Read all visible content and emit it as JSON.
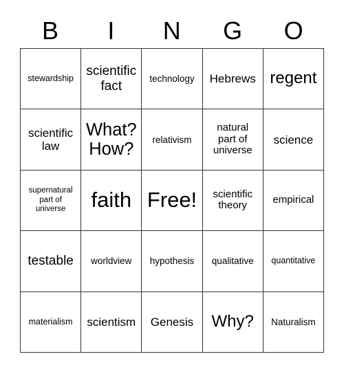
{
  "card": {
    "type": "bingo-card",
    "columns": 5,
    "rows": 5,
    "header_letters": [
      "B",
      "I",
      "N",
      "G",
      "O"
    ],
    "free_space_label": "Free!",
    "grid_line_color": "#333333",
    "background_color": "#ffffff",
    "text_color": "#000000",
    "cells": [
      [
        {
          "text": "stewardship",
          "size": "xs"
        },
        {
          "text": "scientific\nfact",
          "size": "l"
        },
        {
          "text": "technology",
          "size": "s"
        },
        {
          "text": "Hebrews",
          "size": "ml"
        },
        {
          "text": "regent",
          "size": "xl"
        }
      ],
      [
        {
          "text": "scientific\nlaw",
          "size": "ml"
        },
        {
          "text": "What?\nHow?",
          "size": "xxl"
        },
        {
          "text": "relativism",
          "size": "s"
        },
        {
          "text": "natural\npart of\nuniverse",
          "size": "m"
        },
        {
          "text": "science",
          "size": "ml"
        }
      ],
      [
        {
          "text": "supernatural\npart of\nuniverse",
          "size": "xxs"
        },
        {
          "text": "faith",
          "size": "huge"
        },
        {
          "text": "Free!",
          "size": "huge"
        },
        {
          "text": "scientific\ntheory",
          "size": "m"
        },
        {
          "text": "empirical",
          "size": "m"
        }
      ],
      [
        {
          "text": "testable",
          "size": "l"
        },
        {
          "text": "worldview",
          "size": "s"
        },
        {
          "text": "hypothesis",
          "size": "s"
        },
        {
          "text": "qualitative",
          "size": "s"
        },
        {
          "text": "quantitative",
          "size": "xs"
        }
      ],
      [
        {
          "text": "materialism",
          "size": "xs"
        },
        {
          "text": "scientism",
          "size": "ml"
        },
        {
          "text": "Genesis",
          "size": "ml"
        },
        {
          "text": "Why?",
          "size": "xl"
        },
        {
          "text": "Naturalism",
          "size": "s"
        }
      ]
    ]
  }
}
